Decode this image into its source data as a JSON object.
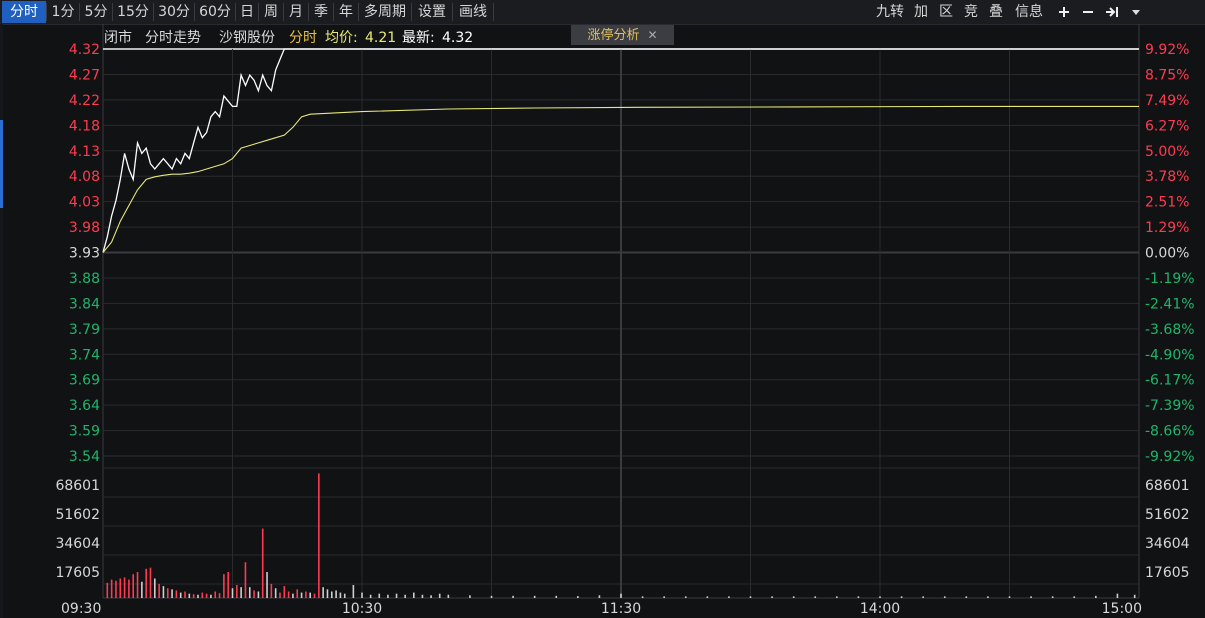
{
  "toolbar": {
    "periods": [
      "分时",
      "1分",
      "5分",
      "15分",
      "30分",
      "60分",
      "日",
      "周",
      "月",
      "季",
      "年",
      "多周期",
      "设置",
      "画线"
    ],
    "active_period": "分时",
    "right_tools": [
      "九转",
      "加",
      "区",
      "竞",
      "叠",
      "信息"
    ],
    "plus_icon": "plus-icon",
    "minus_icon": "minus-icon",
    "jump_icon": "jump-end-icon",
    "dropdown_icon": "chevron-down-icon"
  },
  "info_bar": {
    "status": "闭市",
    "view_name": "分时走势",
    "stock_name": "沙钢股份",
    "mode": "分时",
    "avg_label": "均价:",
    "avg_value": "4.21",
    "latest_label": "最新:",
    "latest_value": "4.32"
  },
  "limit_up_tag": {
    "label": "涨停分析",
    "close": "✕"
  },
  "colors": {
    "up": "#ff3b50",
    "down": "#1fb56b",
    "price_line": "#ffffff",
    "avg_line": "#e8e87a",
    "grid": "#2a2b2f",
    "axis_text": "#d8d8d8"
  },
  "chart_data": [
    {
      "type": "line",
      "title": "",
      "prev_close": 3.93,
      "limit_up": 4.32,
      "limit_down": 3.54,
      "ylim": [
        3.54,
        4.32
      ],
      "price_ticks_up": [
        "4.32",
        "4.27",
        "4.22",
        "4.18",
        "4.13",
        "4.08",
        "4.03",
        "3.98"
      ],
      "price_tick_mid": "3.93",
      "price_ticks_down": [
        "3.88",
        "3.84",
        "3.79",
        "3.74",
        "3.69",
        "3.64",
        "3.59",
        "3.54"
      ],
      "pct_ticks_up": [
        "9.92%",
        "8.75%",
        "7.49%",
        "6.27%",
        "5.00%",
        "3.78%",
        "2.51%",
        "1.29%"
      ],
      "pct_tick_mid": "0.00%",
      "pct_ticks_down": [
        "-1.19%",
        "-2.41%",
        "-3.68%",
        "-4.90%",
        "-6.17%",
        "-7.39%",
        "-8.66%",
        "-9.92%"
      ],
      "x_ticks": [
        "09:30",
        "10:30",
        "11:30",
        "14:00",
        "15:00"
      ],
      "x_range_minutes": [
        0,
        240
      ],
      "series": [
        {
          "name": "分时",
          "x": [
            0,
            1,
            2,
            3,
            4,
            5,
            6,
            7,
            8,
            9,
            10,
            11,
            12,
            13,
            14,
            15,
            16,
            17,
            18,
            19,
            20,
            21,
            22,
            23,
            24,
            25,
            26,
            27,
            28,
            29,
            30,
            31,
            32,
            33,
            34,
            35,
            36,
            37,
            38,
            39,
            40,
            41,
            42,
            43,
            44,
            45,
            46,
            47,
            48,
            240
          ],
          "values": [
            3.93,
            3.96,
            4.0,
            4.03,
            4.07,
            4.12,
            4.09,
            4.07,
            4.14,
            4.12,
            4.13,
            4.1,
            4.09,
            4.1,
            4.11,
            4.1,
            4.09,
            4.11,
            4.1,
            4.12,
            4.11,
            4.14,
            4.17,
            4.15,
            4.16,
            4.19,
            4.2,
            4.19,
            4.23,
            4.22,
            4.21,
            4.21,
            4.27,
            4.25,
            4.27,
            4.26,
            4.24,
            4.27,
            4.25,
            4.24,
            4.28,
            4.3,
            4.32,
            4.32,
            4.32,
            4.32,
            4.32,
            4.32,
            4.32,
            4.32
          ]
        },
        {
          "name": "均价",
          "x": [
            0,
            2,
            4,
            6,
            8,
            10,
            12,
            14,
            16,
            18,
            20,
            22,
            24,
            26,
            28,
            30,
            32,
            34,
            36,
            38,
            40,
            42,
            44,
            46,
            48,
            60,
            80,
            100,
            120,
            160,
            200,
            240
          ],
          "values": [
            3.93,
            3.95,
            3.99,
            4.02,
            4.05,
            4.07,
            4.075,
            4.078,
            4.08,
            4.08,
            4.082,
            4.085,
            4.09,
            4.095,
            4.1,
            4.11,
            4.13,
            4.135,
            4.14,
            4.145,
            4.15,
            4.155,
            4.17,
            4.19,
            4.195,
            4.2,
            4.205,
            4.207,
            4.208,
            4.209,
            4.21,
            4.21
          ]
        }
      ]
    },
    {
      "type": "bar",
      "title": "",
      "ylim": [
        0,
        120000
      ],
      "y_ticks": [
        "68601",
        "51602",
        "34604",
        "17605"
      ],
      "series": [
        {
          "name": "成交量",
          "x": [
            1,
            2,
            3,
            4,
            5,
            6,
            7,
            8,
            9,
            10,
            11,
            12,
            13,
            14,
            15,
            16,
            17,
            18,
            19,
            20,
            21,
            22,
            23,
            24,
            25,
            26,
            27,
            28,
            29,
            30,
            31,
            32,
            33,
            34,
            35,
            36,
            37,
            38,
            39,
            40,
            41,
            42,
            43,
            44,
            45,
            46,
            47,
            48,
            49,
            50,
            51,
            52,
            53,
            54,
            55,
            56,
            58,
            60,
            62,
            64,
            66,
            68,
            70,
            72,
            74,
            76,
            78,
            80,
            85,
            90,
            95,
            100,
            105,
            110,
            115,
            120,
            125,
            130,
            135,
            140,
            145,
            150,
            155,
            160,
            165,
            170,
            175,
            180,
            185,
            190,
            195,
            200,
            205,
            210,
            215,
            220,
            225,
            230,
            235,
            239
          ],
          "values": [
            14000,
            17000,
            16000,
            18000,
            19000,
            17000,
            22000,
            24000,
            15000,
            27000,
            28000,
            18000,
            13000,
            11000,
            9000,
            8000,
            7000,
            5000,
            6000,
            4000,
            3500,
            3000,
            5000,
            4000,
            3000,
            6000,
            4500,
            22000,
            24000,
            9000,
            12000,
            10000,
            33000,
            10000,
            7000,
            6000,
            64000,
            24000,
            13000,
            9000,
            5000,
            11000,
            6000,
            4000,
            8000,
            5000,
            6000,
            5000,
            4000,
            115000,
            10000,
            8000,
            6000,
            7000,
            5000,
            4000,
            12000,
            5000,
            3000,
            4000,
            3000,
            4000,
            3000,
            5000,
            3000,
            2500,
            4000,
            3000,
            2500,
            2000,
            2000,
            2000,
            2000,
            1800,
            2500,
            4000,
            1500,
            1500,
            1500,
            1500,
            1500,
            1500,
            1500,
            1500,
            1500,
            1500,
            1500,
            1500,
            1500,
            1500,
            1500,
            1500,
            1500,
            1500,
            1500,
            1500,
            1500,
            2000,
            4000,
            3000
          ],
          "direction": [
            "up",
            "up",
            "up",
            "up",
            "up",
            "up",
            "up",
            "up",
            "down",
            "up",
            "up",
            "down",
            "up",
            "down",
            "up",
            "down",
            "up",
            "down",
            "up",
            "down",
            "up",
            "down",
            "up",
            "up",
            "down",
            "up",
            "up",
            "up",
            "up",
            "down",
            "up",
            "down",
            "up",
            "down",
            "up",
            "down",
            "up",
            "down",
            "up",
            "down",
            "up",
            "up",
            "up",
            "down",
            "up",
            "down",
            "up",
            "down",
            "up",
            "up",
            "down",
            "down",
            "down",
            "down",
            "down",
            "down",
            "down",
            "down",
            "down",
            "down",
            "down",
            "down",
            "down",
            "down",
            "down",
            "down",
            "down",
            "down",
            "down",
            "down",
            "down",
            "down",
            "down",
            "down",
            "down",
            "down",
            "down",
            "down",
            "down",
            "down",
            "down",
            "down",
            "down",
            "down",
            "down",
            "down",
            "down",
            "down",
            "down",
            "down",
            "down",
            "down",
            "down",
            "down",
            "down",
            "down",
            "down",
            "down",
            "down",
            "down"
          ]
        }
      ]
    }
  ]
}
